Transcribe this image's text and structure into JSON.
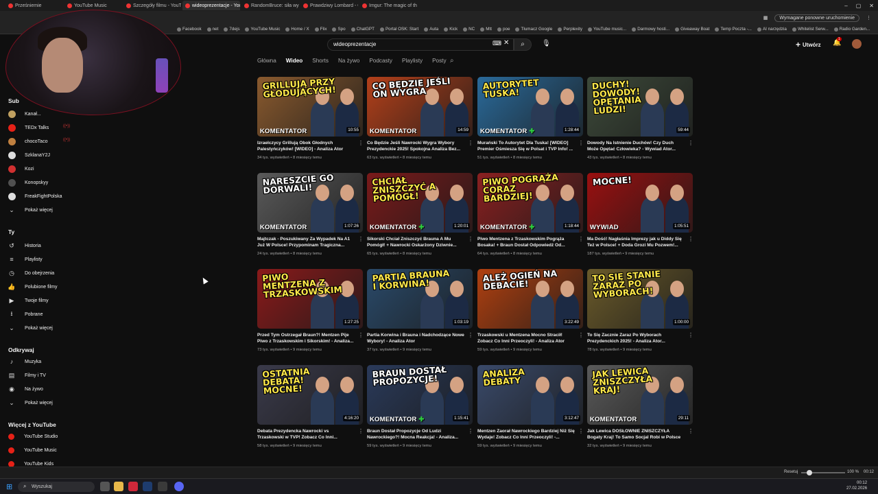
{
  "browser": {
    "tabs": [
      {
        "label": "Prześniemie",
        "active": false
      },
      {
        "label": "YouTube Music",
        "active": false
      },
      {
        "label": "Szczegóły filmu - YouTube",
        "active": false
      },
      {
        "label": "wideoprezentacje - YouTub...",
        "active": true
      },
      {
        "label": "RandomBruce: siła wyższa",
        "active": false
      },
      {
        "label": "Prawdziwy Lombard - Odc...",
        "active": false
      },
      {
        "label": "Imgur: The magic of the Int...",
        "active": false
      }
    ],
    "restart_notice": "Wymagane ponowne uruchomienie",
    "bookmarks": [
      "Facebook",
      "net",
      "7dejs",
      "YouTube Music",
      "Home / X",
      "Flix",
      "Spo",
      "ChatGPT",
      "Portal OSK: Start",
      "Auta",
      "Kick",
      "NC",
      "Mtt",
      "poe",
      "Tłumacz Google",
      "Perplexity",
      "YouTube music...",
      "Darmowy hosti...",
      "Giveaway Boat",
      "Temp Poczta -...",
      "AI narzędzia",
      "Whitelist Serw...",
      "Radio Garden..."
    ]
  },
  "masthead": {
    "search_value": "wideoprezentacje",
    "create_label": "Utwórz",
    "notif_count": "1"
  },
  "channel_tabs": [
    "Główna",
    "Wideo",
    "Shorts",
    "Na żywo",
    "Podcasty",
    "Playlisty",
    "Posty"
  ],
  "sidebar": {
    "subs_heading": "Sub",
    "subscriptions": [
      {
        "label": "Kanał...",
        "color": "#c0a060"
      },
      {
        "label": "TEDx Talks",
        "color": "#e62117"
      },
      {
        "label": "chocoTaco",
        "color": "#c08040"
      },
      {
        "label": "SzklanaY2J",
        "color": "#dddddd"
      },
      {
        "label": "Kozi",
        "color": "#d03030"
      },
      {
        "label": "Konopskyy",
        "color": "#505050"
      },
      {
        "label": "FreakFightPolska",
        "color": "#dddddd"
      }
    ],
    "show_more": "Pokaż więcej",
    "you_heading": "Ty",
    "you_items": [
      {
        "icon": "history-icon",
        "glyph": "↺",
        "label": "Historia"
      },
      {
        "icon": "playlists-icon",
        "glyph": "≡",
        "label": "Playlisty"
      },
      {
        "icon": "watch-later-icon",
        "glyph": "◷",
        "label": "Do obejrzenia"
      },
      {
        "icon": "liked-icon",
        "glyph": "👍",
        "label": "Polubione filmy"
      },
      {
        "icon": "your-videos-icon",
        "glyph": "▶",
        "label": "Twoje filmy"
      },
      {
        "icon": "downloads-icon",
        "glyph": "⭳",
        "label": "Pobrane"
      },
      {
        "icon": "chevron-down-icon",
        "glyph": "⌄",
        "label": "Pokaż więcej"
      }
    ],
    "explore_heading": "Odkrywaj",
    "explore_items": [
      {
        "icon": "music-icon",
        "glyph": "♪",
        "label": "Muzyka"
      },
      {
        "icon": "movies-icon",
        "glyph": "▤",
        "label": "Filmy i TV"
      },
      {
        "icon": "live-icon",
        "glyph": "◉",
        "label": "Na żywo"
      },
      {
        "icon": "chevron-down-icon",
        "glyph": "⌄",
        "label": "Pokaż więcej"
      }
    ],
    "more_heading": "Więcej z YouTube",
    "more_items": [
      {
        "label": "YouTube Studio"
      },
      {
        "label": "YouTube Music"
      },
      {
        "label": "YouTube Kids"
      }
    ]
  },
  "videos": [
    {
      "overlay": "Grillują przy głodujących!",
      "badge": "KOMENTATOR",
      "plus": false,
      "duration": "10:55",
      "title": "Izraelczycy Grillują Obok Głodnych Palestyńczyków! [WIDEO] - Analiza Ator",
      "meta": "34 tys. wyświetleń • 8 miesięcy temu",
      "bg": "#8a5a2e"
    },
    {
      "overlay": "Co będzie jeśli on wygra",
      "badge": "KOMENTATOR",
      "plus": false,
      "duration": "14:59",
      "title": "Co Będzie Jeśli Nawrocki Wygra Wybory Prezydenckie 2025! Spokojna Analiza Bez...",
      "meta": "63 tys. wyświetleń • 8 miesięcy temu",
      "bg": "#b3401a"
    },
    {
      "overlay": "Autorytet Tuska!",
      "badge": "KOMENTATOR",
      "plus": true,
      "duration": "1:28:44",
      "title": "Murański To Autorytet Dla Tuska! [WIDEO] Premier Ośmiesza Się w Polsat i TVP Info! ...",
      "meta": "51 tys. wyświetleń • 8 miesięcy temu",
      "bg": "#2a6a9a"
    },
    {
      "overlay": "Duchy! Dowody! Opętania ludzi!",
      "badge": "",
      "plus": false,
      "duration": "59:44",
      "title": "Dowody Na Istnienie Duchów! Czy Duch Może Opętać Człowieka? - Wywiad Ator...",
      "meta": "43 tys. wyświetleń • 8 miesięcy temu",
      "bg": "#3d4a3a"
    },
    {
      "overlay": "Nareszcie go dorwali!",
      "badge": "KOMENTATOR",
      "plus": false,
      "duration": "1:07:26",
      "title": "Majtczak - Poszukiwany Za Wypadek Na A1 Już W Polsce! Przypominam Tragiczna...",
      "meta": "24 tys. wyświetleń • 8 miesięcy temu",
      "bg": "#5a5a5a"
    },
    {
      "overlay": "Chciał zniszczyć a pomógł!",
      "badge": "KOMENTATOR",
      "plus": true,
      "duration": "1:20:01",
      "title": "Sikorski Chciał Zniszczyć Brauna A Mu Pomógł! + Nawrocki Oskarżony Dziwnie...",
      "meta": "65 tys. wyświetleń • 8 miesięcy temu",
      "bg": "#7a1a1a"
    },
    {
      "overlay": "Piwo pogrąża coraz bardziej!",
      "badge": "KOMENTATOR",
      "plus": true,
      "duration": "1:18:44",
      "title": "Piwo Mentzena z Trzaskowskim Pogrąża Bosaka! + Braun Dostał Odpowiedź Od...",
      "meta": "64 tys. wyświetleń • 8 miesięcy temu",
      "bg": "#8a2020"
    },
    {
      "overlay": "Mocne!",
      "badge": "WYWIAD",
      "plus": false,
      "duration": "1:05:51",
      "title": "Ma Dość! Nagłaśnia Imprezy jak u Diddy Się Też w Polsce! + Doda Grozi Mu Pozwem!...",
      "meta": "187 tys. wyświetleń • 9 miesięcy temu",
      "bg": "#9a1010"
    },
    {
      "overlay": "Piwo Mentzena z Trzaskowskim",
      "badge": "",
      "plus": false,
      "duration": "1:27:25",
      "title": "Przed Tym Ostrzegał Braun?! Mentzen Pije Piwo z Trzaskowskim i Sikorskim! - Analiza...",
      "meta": "73 tys. wyświetleń • 9 miesięcy temu",
      "bg": "#8a1a1a"
    },
    {
      "overlay": "Partia Brauna i Korwina!",
      "badge": "",
      "plus": false,
      "duration": "1:03:19",
      "title": "Partia Korwina i Brauna i Nadchodzące Nowe Wybory! - Analiza Ator",
      "meta": "37 tys. wyświetleń • 9 miesięcy temu",
      "bg": "#2a4a6a"
    },
    {
      "overlay": "Ależ ogień na debacie!",
      "badge": "",
      "plus": false,
      "duration": "3:22:49",
      "title": "Trzaskowski u Mentzena Mocno Stracił! Zobacz Co Inni Przeoczyli! - Analiza Ator",
      "meta": "59 tys. wyświetleń • 9 miesięcy temu",
      "bg": "#b04010"
    },
    {
      "overlay": "To się stanie zaraz po wyborach!",
      "badge": "",
      "plus": false,
      "duration": "1:00:00",
      "title": "To Się Zacznie Zaraz Po Wyborach Prezydenckich 2025! - Analiza Ator...",
      "meta": "78 tys. wyświetleń • 9 miesięcy temu",
      "bg": "#6a5a2a"
    },
    {
      "overlay": "Ostatnia debata! Mocne!",
      "badge": "",
      "plus": false,
      "duration": "4:16:20",
      "title": "Debata Prezydencka Nawrocki vs Trzaskowski w TVP! Zobacz Co Inni...",
      "meta": "58 tys. wyświetleń • 9 miesięcy temu",
      "bg": "#3a3a4a"
    },
    {
      "overlay": "Braun dostał propozycje!",
      "badge": "KOMENTATOR",
      "plus": true,
      "duration": "1:15:41",
      "title": "Braun Dostał Propozycje Od Ludzi Nawrockiego?! Mocna Reakcja! - Analiza...",
      "meta": "59 tys. wyświetleń • 9 miesięcy temu",
      "bg": "#2a3a5a"
    },
    {
      "overlay": "Analiza debaty",
      "badge": "",
      "plus": false,
      "duration": "3:12:47",
      "title": "Mentzen Zaorał Nawrockiego Bardziej Niż Się Wydaje! Zobacz Co Inni Przeoczyli! -...",
      "meta": "59 tys. wyświetleń • 9 miesięcy temu",
      "bg": "#3a4a6a"
    },
    {
      "overlay": "Jak lewica zniszczyła kraj!",
      "badge": "KOMENTATOR",
      "plus": false,
      "duration": "29:11",
      "title": "Jak Lewica DOSŁOWNIE ZNISZCZYŁA Bogaty Kraj! To Samo Socjal Robi w Polsce ...",
      "meta": "32 tys. wyświetleń • 9 miesięcy temu",
      "bg": "#5a5a5a"
    }
  ],
  "status": {
    "reset": "Resetuj",
    "zoom": "100 %",
    "clock": "00:12"
  },
  "taskbar": {
    "search_placeholder": "Wyszukaj",
    "time": "00:12",
    "date": "27.02.2026"
  }
}
